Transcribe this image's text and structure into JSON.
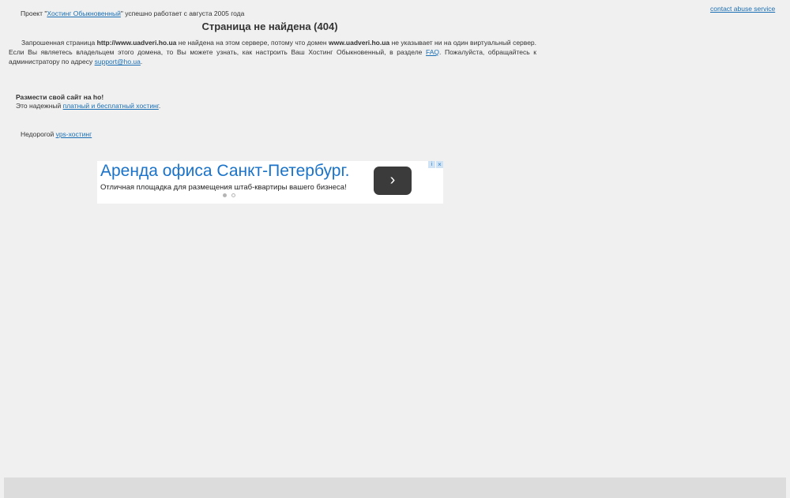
{
  "header": {
    "abuse_link": "contact abuse service",
    "intro_prefix": "Проект \"",
    "intro_link": "Хостинг Обыкновенный",
    "intro_suffix": "\" успешно работает с августа 2005 года"
  },
  "main": {
    "title": "Страница не найдена (404)",
    "para_1": "Запрошенная страница ",
    "requested_url": "http://www.uadveri.ho.ua",
    "para_2": " не найдена на этом сервере, потому что домен ",
    "domain": "www.uadveri.ho.ua",
    "para_3": " не указывает ни на один виртуальный сервер. Если Вы являетесь владельцем этого домена, то Вы можете узнать, как настроить Ваш Хостинг Обыкновенный, в разделе ",
    "faq_link": "FAQ",
    "para_4": ". Пожалуйста, обращайтесь к администратору по адресу ",
    "support_email": "support@ho.ua",
    "para_5": "."
  },
  "promo": {
    "heading": "Размести свой сайт на ho!",
    "text_prefix": "Это надежный ",
    "hosting_link": "платный и бесплатный хостинг",
    "text_suffix": "."
  },
  "vps": {
    "prefix": "Недорогой ",
    "link": "vps-хостинг"
  },
  "ad": {
    "title": "Аренда офиса Санкт-Петербург.",
    "subtitle": "Отличная площадка для размещения штаб-квартиры вашего бизнеса!",
    "arrow": "›",
    "info": "i",
    "close": "×",
    "slide_count": 2,
    "active_slide": 1
  }
}
